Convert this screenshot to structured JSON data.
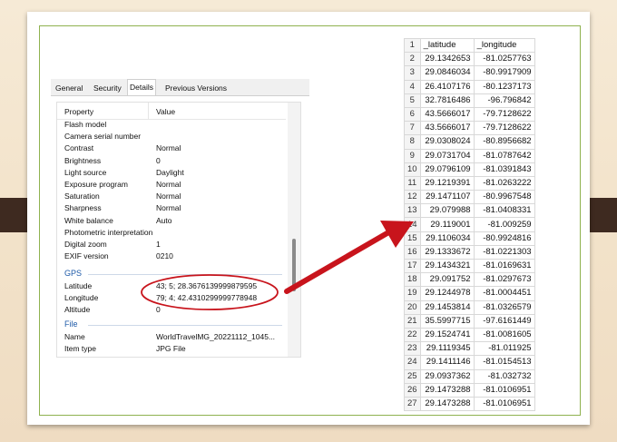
{
  "dialog": {
    "tabs": [
      "General",
      "Security",
      "Details",
      "Previous Versions"
    ],
    "active_tab": "Details",
    "columns": {
      "property": "Property",
      "value": "Value"
    },
    "rows_top": [
      {
        "p": "Flash model",
        "v": ""
      },
      {
        "p": "Camera serial number",
        "v": ""
      },
      {
        "p": "Contrast",
        "v": "Normal"
      },
      {
        "p": "Brightness",
        "v": "0"
      },
      {
        "p": "Light source",
        "v": "Daylight"
      },
      {
        "p": "Exposure program",
        "v": "Normal"
      },
      {
        "p": "Saturation",
        "v": "Normal"
      },
      {
        "p": "Sharpness",
        "v": "Normal"
      },
      {
        "p": "White balance",
        "v": "Auto"
      },
      {
        "p": "Photometric interpretation",
        "v": ""
      },
      {
        "p": "Digital zoom",
        "v": "1"
      },
      {
        "p": "EXIF version",
        "v": "0210"
      }
    ],
    "gps_label": "GPS",
    "gps_rows": [
      {
        "p": "Latitude",
        "v": "43; 5; 28.3676139999879595"
      },
      {
        "p": "Longitude",
        "v": "79; 4; 42.4310299999778948"
      },
      {
        "p": "Altitude",
        "v": "0"
      }
    ],
    "file_label": "File",
    "file_rows": [
      {
        "p": "Name",
        "v": "WorldTravelMG_20221112_1045..."
      },
      {
        "p": "Item type",
        "v": "JPG File"
      }
    ]
  },
  "sheet": {
    "headers": [
      "_latitude",
      "_longitude"
    ],
    "rows": [
      [
        "29.1342653",
        "-81.0257763"
      ],
      [
        "29.0846034",
        "-80.9917909"
      ],
      [
        "26.4107176",
        "-80.1237173"
      ],
      [
        "32.7816486",
        "-96.796842"
      ],
      [
        "43.5666017",
        "-79.7128622"
      ],
      [
        "43.5666017",
        "-79.7128622"
      ],
      [
        "29.0308024",
        "-80.8956682"
      ],
      [
        "29.0731704",
        "-81.0787642"
      ],
      [
        "29.0796109",
        "-81.0391843"
      ],
      [
        "29.1219391",
        "-81.0263222"
      ],
      [
        "29.1471107",
        "-80.9967548"
      ],
      [
        "29.079988",
        "-81.0408331"
      ],
      [
        "29.119001",
        "-81.009259"
      ],
      [
        "29.1106034",
        "-80.9924816"
      ],
      [
        "29.1333672",
        "-81.0221303"
      ],
      [
        "29.1434321",
        "-81.0169631"
      ],
      [
        "29.091752",
        "-81.0297673"
      ],
      [
        "29.1244978",
        "-81.0004451"
      ],
      [
        "29.1453814",
        "-81.0326579"
      ],
      [
        "35.5997715",
        "-97.6161449"
      ],
      [
        "29.1524741",
        "-81.0081605"
      ],
      [
        "29.1119345",
        "-81.011925"
      ],
      [
        "29.1411146",
        "-81.0154513"
      ],
      [
        "29.0937362",
        "-81.032732"
      ],
      [
        "29.1473288",
        "-81.0106951"
      ],
      [
        "29.1473288",
        "-81.0106951"
      ]
    ]
  },
  "colors": {
    "annotation": "#c8141c",
    "frame": "#8fb24f",
    "side_tabs": "#3e2a20"
  },
  "icons": {
    "annotation_arrow": "arrow-icon",
    "annotation_ellipse": "ellipse-highlight"
  }
}
